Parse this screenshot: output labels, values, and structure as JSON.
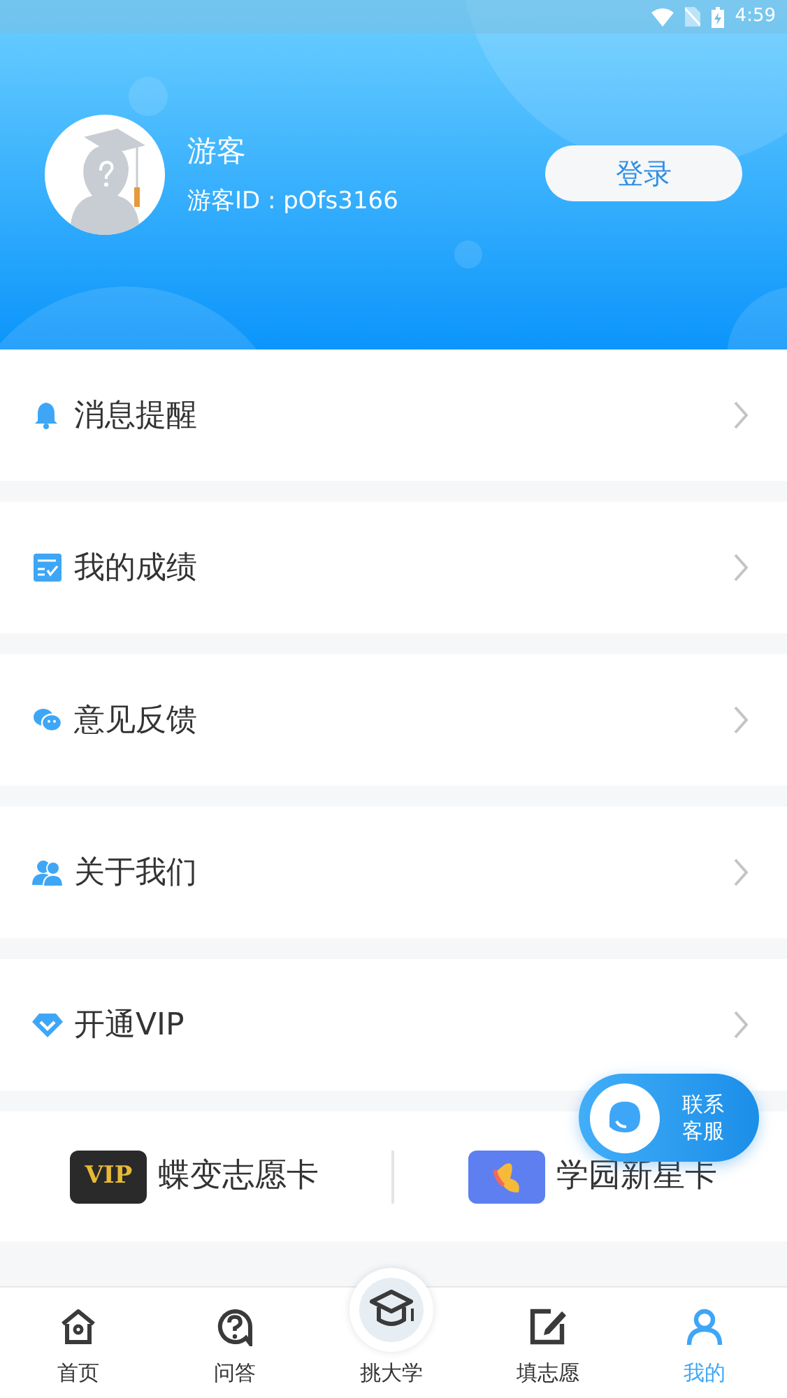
{
  "status_bar": {
    "time": "4:59"
  },
  "profile": {
    "name": "游客",
    "guest_id": "游客ID : pOfs3166",
    "login_button": "登录"
  },
  "menu": [
    {
      "kind": "bell",
      "label": "消息提醒"
    },
    {
      "kind": "score",
      "label": "我的成绩"
    },
    {
      "kind": "feedback",
      "label": "意见反馈"
    },
    {
      "kind": "about",
      "label": "关于我们"
    },
    {
      "kind": "vip",
      "label": "开通VIP"
    }
  ],
  "cards": [
    {
      "kind": "vip",
      "badge": "VIP",
      "label": "蝶变志愿卡"
    },
    {
      "kind": "star",
      "label": "学园新星卡"
    }
  ],
  "contact_button": {
    "line_1": "联系",
    "line_2": "客服"
  },
  "tabs": [
    {
      "kind": "home",
      "label": "首页",
      "selected": false
    },
    {
      "kind": "qa",
      "label": "问答",
      "selected": false
    },
    {
      "kind": "college",
      "label": "挑大学",
      "selected": false
    },
    {
      "kind": "fill",
      "label": "填志愿",
      "selected": false
    },
    {
      "kind": "me",
      "label": "我的",
      "selected": true
    }
  ]
}
